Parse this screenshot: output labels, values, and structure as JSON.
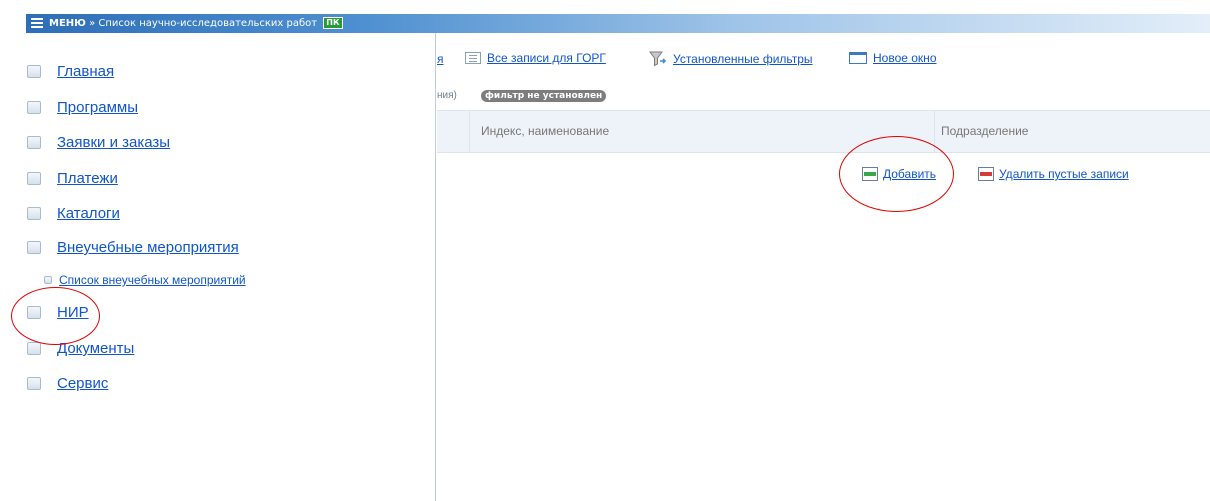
{
  "topbar": {
    "menu_label": "МЕНЮ",
    "separator": "»",
    "page_title": "Список научно-исследовательских работ",
    "badge": "ПК"
  },
  "sidebar": {
    "items": [
      {
        "label": "Главная"
      },
      {
        "label": "Программы"
      },
      {
        "label": "Заявки и заказы"
      },
      {
        "label": "Платежи"
      },
      {
        "label": "Каталоги"
      },
      {
        "label": "Внеучебные мероприятия"
      },
      {
        "label": "Список внеучебных мероприятий"
      },
      {
        "label": "НИР"
      },
      {
        "label": "Документы"
      },
      {
        "label": "Сервис"
      }
    ]
  },
  "toolbar": {
    "cut_fragment": "я",
    "all_records_label": "Все записи для ГОРГ",
    "filters_label": "Установленные фильтры",
    "new_window_label": "Новое окно"
  },
  "filter": {
    "prefix": "ния)",
    "badge": "фильтр не установлен"
  },
  "table": {
    "columns": [
      "Индекс, наименование",
      "Подразделение"
    ]
  },
  "actions": {
    "add_label": "Добавить",
    "delete_empty_label": "Удалить пустые записи"
  },
  "colors": {
    "link": "#1155cc",
    "annotation": "#e00000",
    "badge_green": "#2b9a3a"
  },
  "icons": {
    "menu": "menu-icon",
    "list": "list-icon",
    "filter": "filter-icon",
    "window": "window-icon",
    "add": "add-record-icon",
    "delete": "delete-record-icon"
  }
}
